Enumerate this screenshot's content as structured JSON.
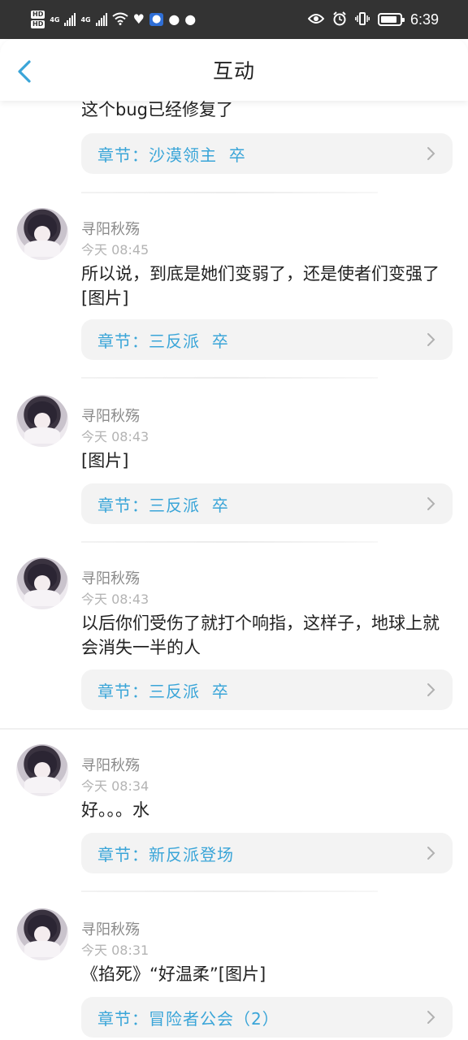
{
  "status_bar": {
    "sim1": "HD",
    "sim2": "HD",
    "net1": "4G",
    "net2": "4G",
    "time": "6:39",
    "battery_level": 0.85,
    "icons": [
      "signal-icon",
      "wifi-icon",
      "heart-icon",
      "bulb-icon",
      "chat-bubble-icon",
      "wechat-icon",
      "eye-icon",
      "alarm-icon",
      "vibrate-icon",
      "battery-icon"
    ]
  },
  "header": {
    "title": "互动",
    "back_icon": "chevron-left-icon"
  },
  "accent_color": "#3aa5d8",
  "first_item": {
    "text": "这个bug已经修复了",
    "chapter": "章节：沙漠领主  卒"
  },
  "comments": [
    {
      "user": "寻阳秋殇",
      "time": "今天 08:45",
      "text": "所以说，到底是她们变弱了，还是使者们变强了[图片]",
      "chapter": "章节：三反派  卒"
    },
    {
      "user": "寻阳秋殇",
      "time": "今天 08:43",
      "text": "[图片]",
      "chapter": "章节：三反派  卒"
    },
    {
      "user": "寻阳秋殇",
      "time": "今天 08:43",
      "text": "以后你们受伤了就打个响指，这样子，地球上就会消失一半的人",
      "chapter": "章节：三反派  卒"
    },
    {
      "user": "寻阳秋殇",
      "time": "今天 08:34",
      "text": "好。。。水",
      "chapter": "章节：新反派登场"
    },
    {
      "user": "寻阳秋殇",
      "time": "今天 08:31",
      "text": "《掐死》“好温柔”[图片]",
      "chapter": "章节：冒险者公会（2）"
    }
  ]
}
